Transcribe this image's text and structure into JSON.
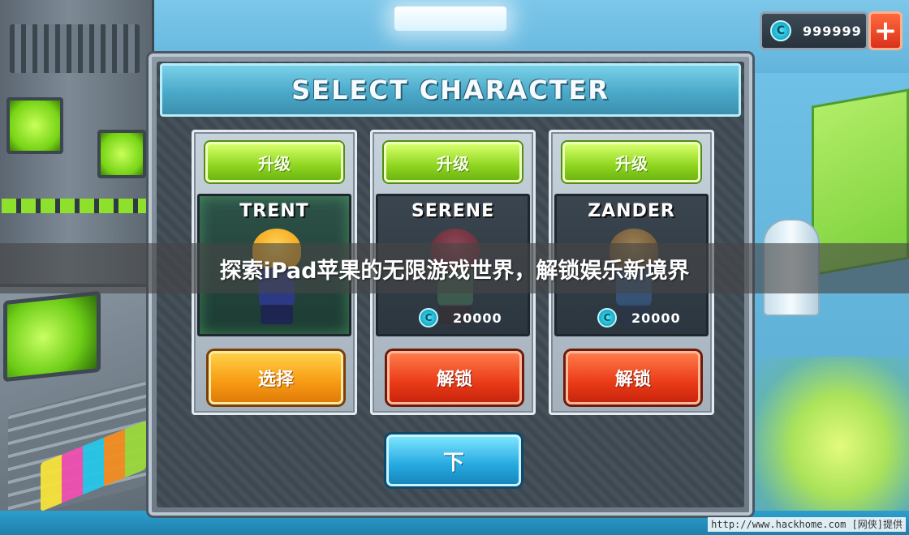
{
  "currency": {
    "amount": "999999",
    "coin_symbol": "C",
    "add_symbol": "+"
  },
  "title": "SELECT CHARACTER",
  "characters": [
    {
      "name": "TRENT",
      "upgrade_label": "升级",
      "action_label": "选择",
      "status": "selected"
    },
    {
      "name": "SERENE",
      "upgrade_label": "升级",
      "price": "20000",
      "coin_symbol": "C",
      "action_label": "解锁",
      "status": "locked"
    },
    {
      "name": "ZANDER",
      "upgrade_label": "升级",
      "price": "20000",
      "coin_symbol": "C",
      "action_label": "解锁",
      "status": "locked"
    }
  ],
  "next_label": "下",
  "banner": "探索iPad苹果的无限游戏世界，解锁娱乐新境界",
  "watermark": "http://www.hackhome.com [网侠]提供",
  "colors": {
    "upgrade_green": "#8fd620",
    "select_orange": "#f79a12",
    "unlock_red": "#ea3b18",
    "next_blue": "#25a9e0",
    "title_cyan": "#4aa9c9"
  }
}
